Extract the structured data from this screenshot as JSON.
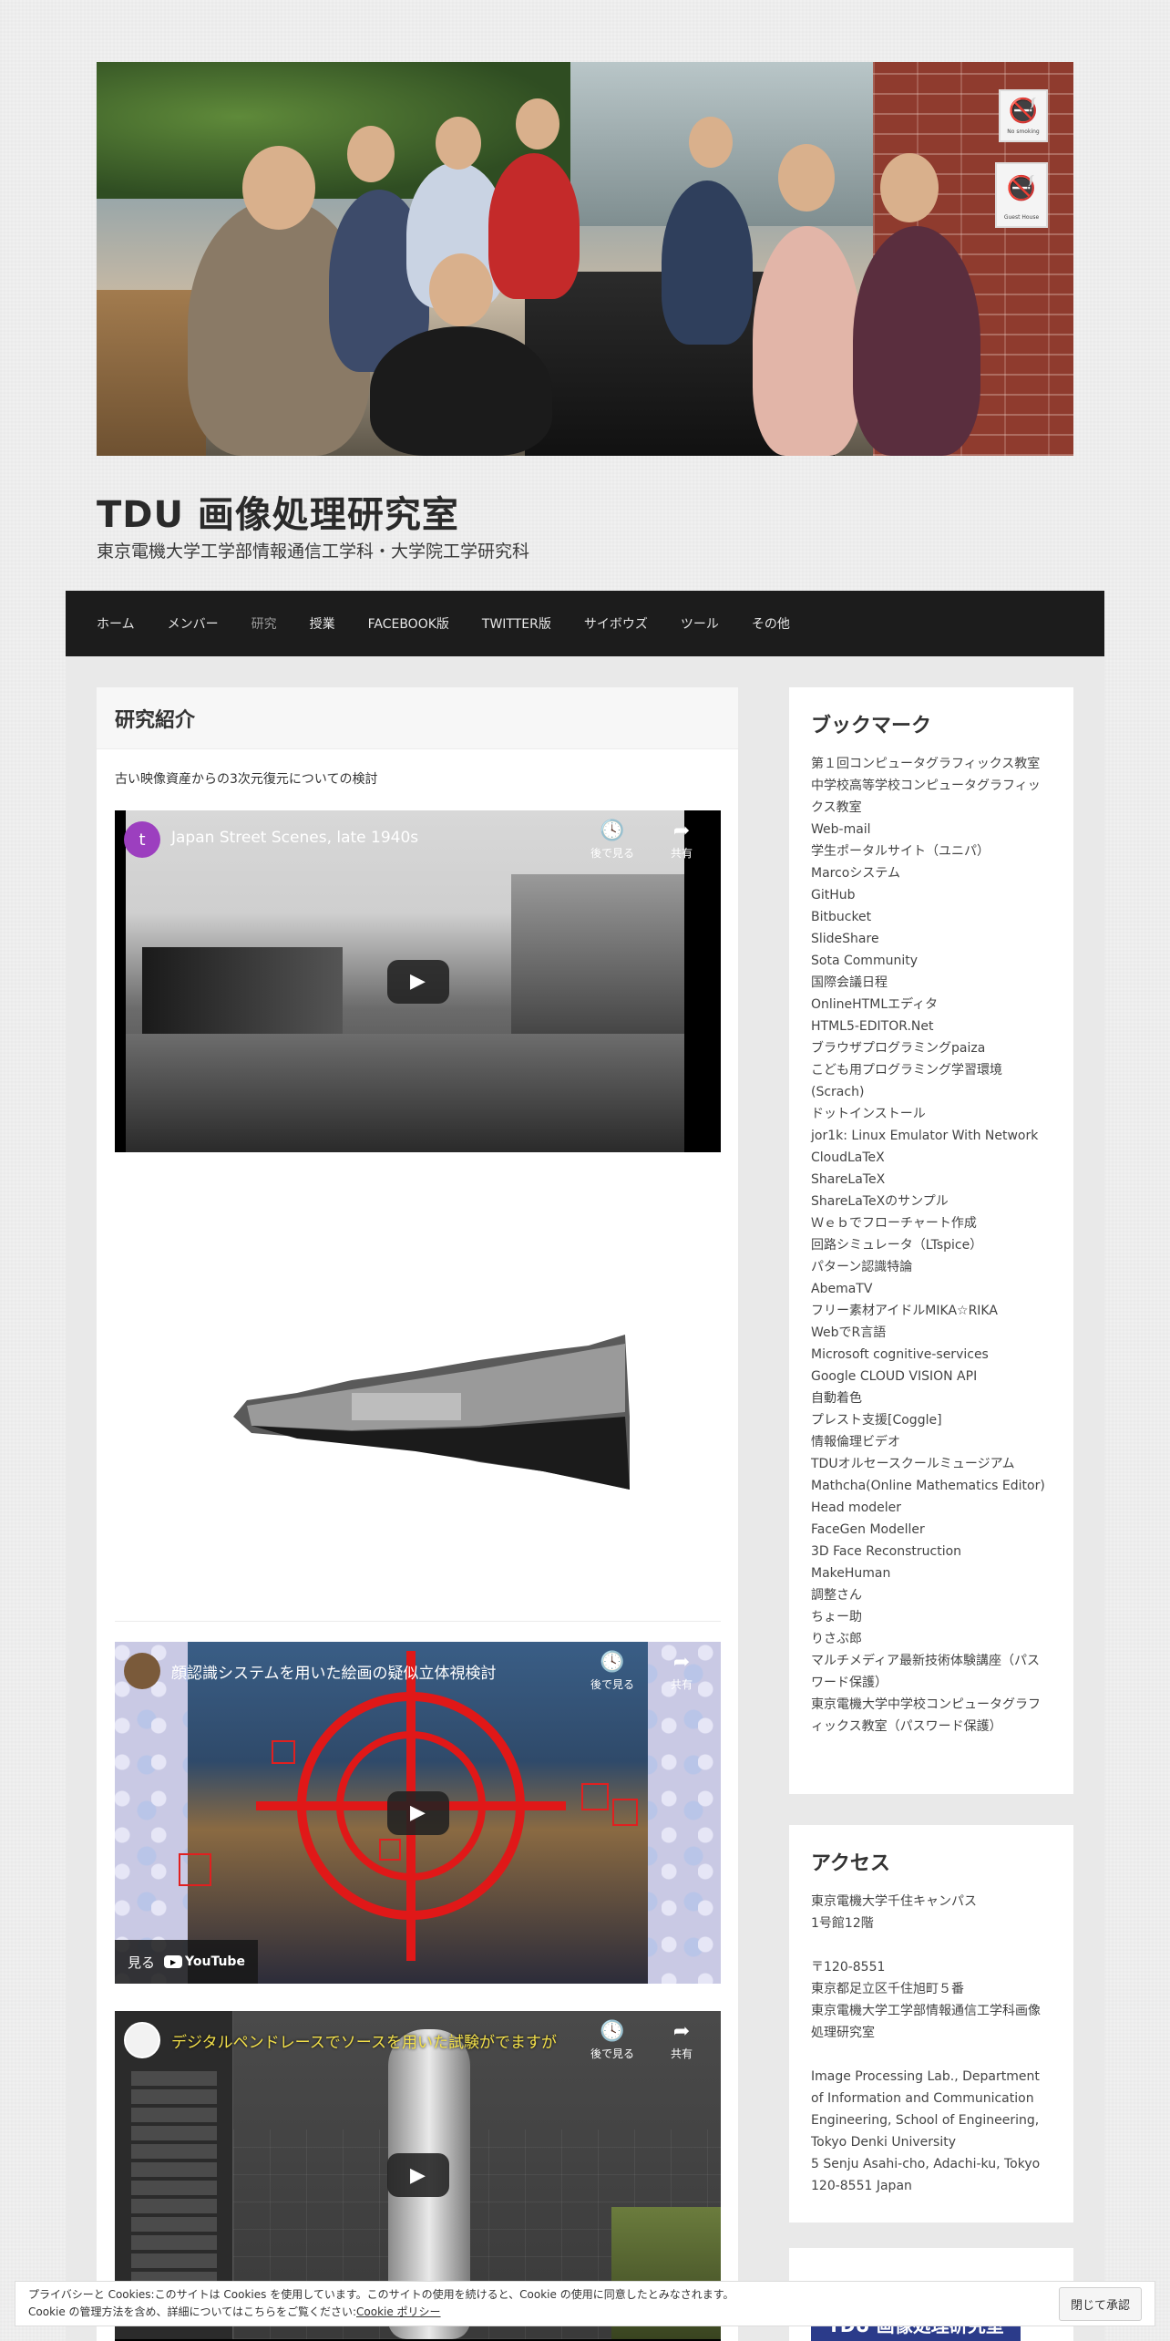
{
  "site": {
    "title": "TDU 画像処理研究室",
    "description": "東京電機大学工学部情報通信工学科・大学院工学研究科"
  },
  "header_photo": {
    "sign_no_smoking": "No smoking",
    "sign_board": "Guest House"
  },
  "nav": {
    "items": [
      "ホーム",
      "メンバー",
      "研究",
      "授業",
      "FACEBOOK版",
      "TWITTER版",
      "サイボウズ",
      "ツール",
      "その他"
    ],
    "current_index": 2
  },
  "article": {
    "title": "研究紹介",
    "intro": "古い映像資産からの3次元復元についての検討"
  },
  "videos": [
    {
      "title": "Japan Street Scenes, late 1940s",
      "avatar_letter": "t",
      "avatar_color": "#9c3fbf",
      "watch_later": "後で見る",
      "share": "共有"
    },
    {
      "title": "顔認識システムを用いた絵画の疑似立体視検討",
      "watch_later": "後で見る",
      "share": "共有",
      "watch_on": "見る",
      "youtube": "YouTube"
    },
    {
      "title": "デジタルペンドレースでソースを用いた試験がでますが",
      "watch_later": "後で見る",
      "share": "共有"
    }
  ],
  "bookmarks": {
    "title": "ブックマーク",
    "links": [
      "第１回コンピュータグラフィックス教室",
      "中学校高等学校コンピュータグラフィックス教室",
      "Web-mail",
      "学生ポータルサイト（ユニパ）",
      "Marcoシステム",
      "GitHub",
      "Bitbucket",
      "SlideShare",
      "Sota Community",
      "国際会議日程",
      "OnlineHTMLエディタ",
      "HTML5-EDITOR.Net",
      "ブラウザプログラミングpaiza",
      "こども用プログラミング学習環境(Scrach)",
      "ドットインストール",
      "jor1k: Linux Emulator With Network",
      "CloudLaTeX",
      "ShareLaTeX",
      "ShareLaTeXのサンプル",
      "Ｗｅｂでフローチャート作成",
      "回路シミュレータ（LTspice）",
      "パターン認識特論",
      "AbemaTV",
      "フリー素材アイドルMIKA☆RIKA",
      "WebでR言語",
      "Microsoft cognitive-services",
      "Google CLOUD VISION API",
      "自動着色",
      "プレスト支援[Coggle]",
      "情報倫理ビデオ",
      "TDUオルセースクールミュージアム",
      "Mathcha(Online Mathematics Editor)",
      "Head modeler",
      "FaceGen Modeller",
      "3D Face Reconstruction",
      "MakeHuman",
      "調整さん",
      "ちょー助",
      "りさぶ郎",
      "マルチメディア最新技術体験講座（パスワード保護）",
      "東京電機大学中学校コンピュータグラフィックス教室（パスワード保護）"
    ]
  },
  "access": {
    "title": "アクセス",
    "jp_lines": [
      "東京電機大学千住キャンパス",
      "1号館12階"
    ],
    "jp_address": [
      "〒120-8551",
      "東京都足立区千住旭町５番",
      "東京電機大学工学部情報通信工学科画像処理研究室"
    ],
    "en_address": [
      "Image Processing Lab., Department of Information and Communication Engineering, School of Engineering, Tokyo Denki University",
      "5 Senju Asahi-cho, Adachi-ku, Tokyo 120-8551 Japan"
    ]
  },
  "widget3": {
    "logo_text": "TDU 画像処理研究室"
  },
  "cookie": {
    "line1": "プライバシーと Cookies:このサイトは Cookies を使用しています。このサイトの使用を続けると、Cookie の使用に同意したとみなされます。",
    "line2": "Cookie の管理方法を含め、詳細についてはこちらをご覧ください:",
    "policy_link": "Cookie ポリシー",
    "accept": "閉じて承認"
  },
  "colors": {
    "nav_bg": "#1c1c1c",
    "face_box": "#e02020"
  }
}
